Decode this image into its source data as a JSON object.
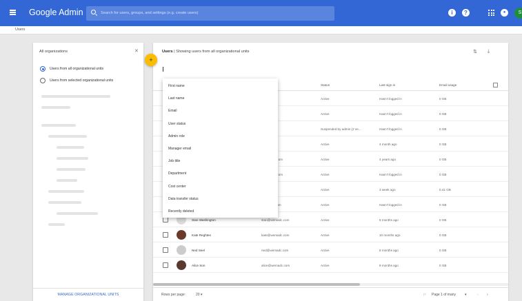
{
  "app": {
    "title": "Google Admin",
    "search_placeholder": "Search for users, groups, and settings (e.g. create users)",
    "avatar_initial": "S",
    "brand_color": "#3367d6"
  },
  "breadcrumb": "Users",
  "sidebar": {
    "title": "All organizations",
    "radio_all": "Users from all organizational units",
    "radio_selected": "Users from selected organizational units",
    "manage_label": "MANAGE ORGANIZATIONAL UNITS"
  },
  "main": {
    "title_bold": "Users",
    "title_rest": " | Showing users from all organizational units",
    "columns": [
      "Status",
      "Last sign in",
      "Email usage"
    ],
    "dropdown": [
      "First name",
      "Last name",
      "Email",
      "User status",
      "Admin role",
      "Manager email",
      "Job title",
      "Department",
      "Cost center",
      "Data transfer status",
      "Recently deleted"
    ],
    "rows": [
      {
        "name": "",
        "email": "...ala.com",
        "status": "Active",
        "last": "Hasn't logged in",
        "usage": "0 GB"
      },
      {
        "name": "",
        "email": "...ala.com",
        "status": "Active",
        "last": "Hasn't logged in",
        "usage": "0 GB"
      },
      {
        "name": "",
        "email": "...ala.com",
        "status": "Suspended by admin (2 ve...",
        "last": "Hasn't logged in",
        "usage": "0 GB"
      },
      {
        "name": "",
        "email": "...wemadc.com",
        "status": "Active",
        "last": "4 month ago",
        "usage": "0 GB"
      },
      {
        "name": "",
        "email": "...g@wemadc.com",
        "status": "Active",
        "last": "4 years ago",
        "usage": "0 GB"
      },
      {
        "name": "",
        "email": "...g@wemadc.com",
        "status": "Active",
        "last": "Hasn't logged in",
        "usage": "0 GB"
      },
      {
        "name": "",
        "email": "...madc.com",
        "status": "Active",
        "last": "3 week ago",
        "usage": "0.41 GB"
      },
      {
        "name": "",
        "email": "...@wemadc.com",
        "status": "Active",
        "last": "Hasn't logged in",
        "usage": "0 GB"
      },
      {
        "name": "Stan Washington",
        "email": "stan@wemadc.com",
        "status": "Active",
        "last": "8 months ago",
        "usage": "0 GB"
      },
      {
        "name": "Kate Reghten",
        "email": "kate@wemadc.com",
        "status": "Active",
        "last": "10 months ago",
        "usage": "0 GB"
      },
      {
        "name": "Ned Seel",
        "email": "ned@wemadc.com",
        "status": "Active",
        "last": "8 months ago",
        "usage": "0 GB"
      },
      {
        "name": "Alice Son",
        "email": "alice@wemadc.com",
        "status": "Active",
        "last": "9 months ago",
        "usage": "0 GB"
      }
    ],
    "rows_per_page_label": "Rows per page:",
    "rows_per_page_value": "20",
    "page_label": "Page 1 of many"
  }
}
